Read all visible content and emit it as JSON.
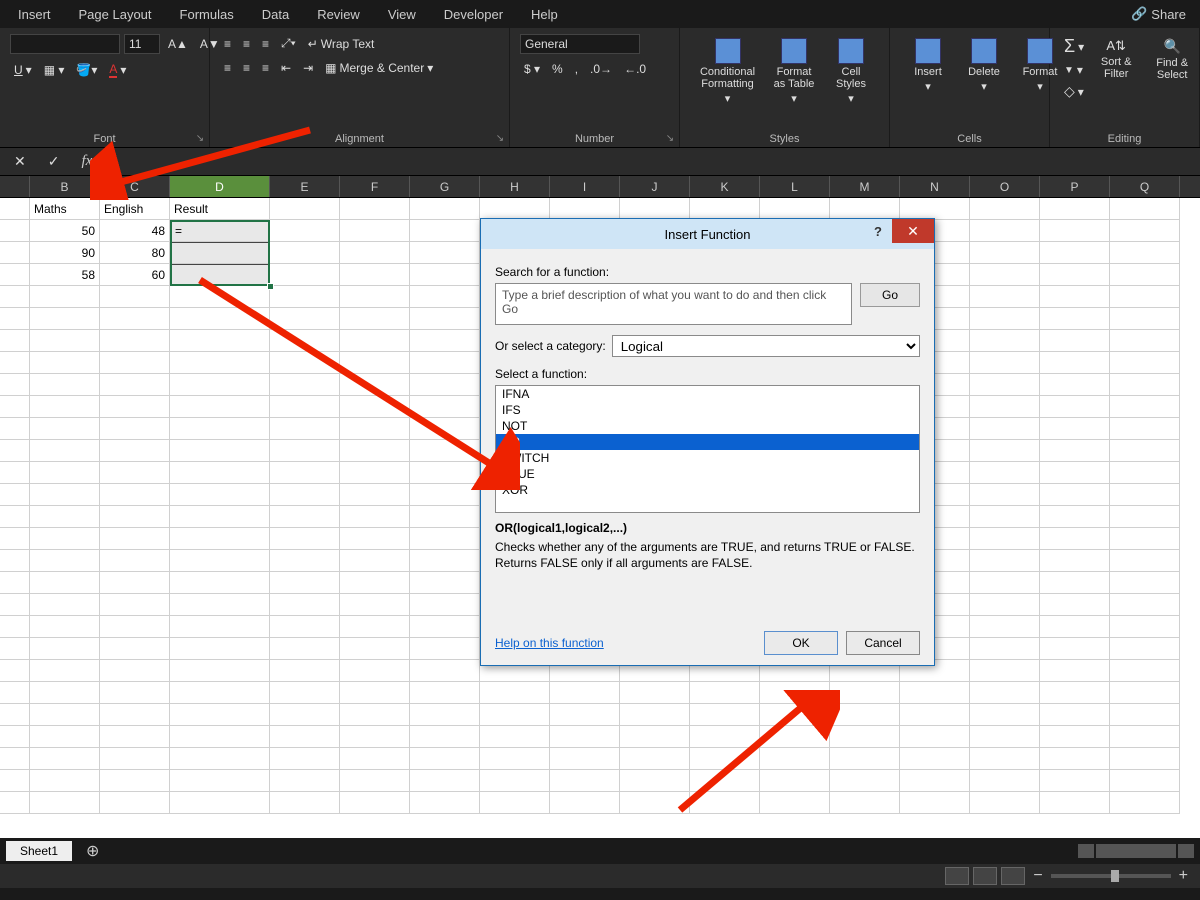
{
  "ribbonTabs": [
    "Insert",
    "Page Layout",
    "Formulas",
    "Data",
    "Review",
    "View",
    "Developer",
    "Help"
  ],
  "share": "Share",
  "font": {
    "size": "11"
  },
  "wrapText": "Wrap Text",
  "mergeCenter": "Merge & Center",
  "numberFormat": "General",
  "groups": {
    "font": "Font",
    "alignment": "Alignment",
    "number": "Number",
    "styles": "Styles",
    "cells": "Cells",
    "editing": "Editing"
  },
  "stylesBtns": {
    "cond": "Conditional Formatting",
    "fmtTable": "Format as Table",
    "cellStyles": "Cell Styles"
  },
  "cellsBtns": {
    "insert": "Insert",
    "delete": "Delete",
    "format": "Format"
  },
  "editingBtns": {
    "sort": "Sort & Filter",
    "find": "Find & Select"
  },
  "columns": [
    "B",
    "C",
    "D",
    "E",
    "F",
    "G",
    "H",
    "I",
    "J",
    "K",
    "L",
    "M",
    "N",
    "O",
    "P",
    "Q"
  ],
  "headers": {
    "b": "Maths",
    "c": "English",
    "d": "Result"
  },
  "rows": [
    {
      "b": "50",
      "c": "48",
      "d": "="
    },
    {
      "b": "90",
      "c": "80",
      "d": ""
    },
    {
      "b": "58",
      "c": "60",
      "d": ""
    }
  ],
  "sheet": "Sheet1",
  "dialog": {
    "title": "Insert Function",
    "searchLabel": "Search for a function:",
    "searchPlaceholder": "Type a brief description of what you want to do and then click Go",
    "go": "Go",
    "catLabel": "Or select a category:",
    "category": "Logical",
    "selectLabel": "Select a function:",
    "functions": [
      "IFNA",
      "IFS",
      "NOT",
      "OR",
      "SWITCH",
      "TRUE",
      "XOR"
    ],
    "selected": "OR",
    "syntax": "OR(logical1,logical2,...)",
    "desc": "Checks whether any of the arguments are TRUE, and returns TRUE or FALSE. Returns FALSE only if all arguments are FALSE.",
    "help": "Help on this function",
    "ok": "OK",
    "cancel": "Cancel"
  }
}
